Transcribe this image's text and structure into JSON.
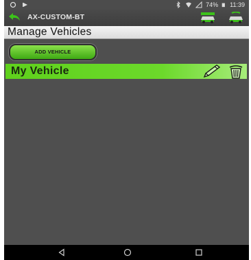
{
  "status_bar": {
    "battery": "74%",
    "clock": "11:39"
  },
  "app_header": {
    "title": "AX-CUSTOM-BT"
  },
  "page": {
    "title": "Manage Vehicles"
  },
  "toolbar": {
    "add_vehicle_label": "ADD VEHICLE"
  },
  "vehicles": [
    {
      "name": "My Vehicle"
    }
  ],
  "colors": {
    "accent_green": "#5fd11c",
    "background": "#4f4f4f",
    "title_bar": "#e8e8e8"
  },
  "icons": {
    "back": "back-arrow-icon",
    "edit": "pencil-icon",
    "delete": "trash-icon",
    "bluetooth": "bluetooth-icon",
    "wifi": "wifi-icon"
  }
}
